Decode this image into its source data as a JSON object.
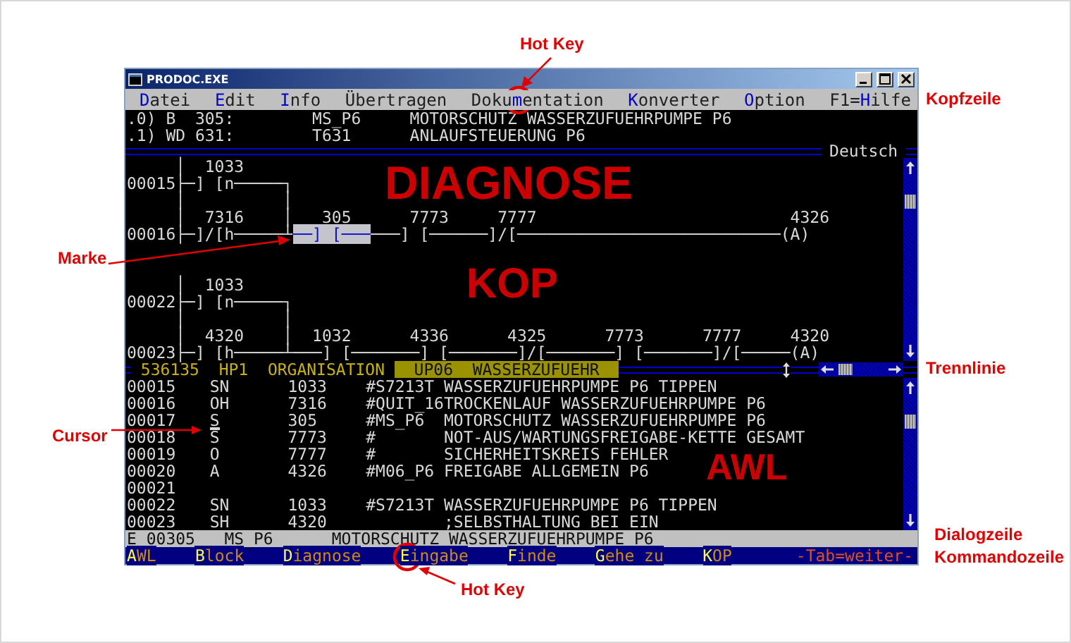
{
  "annotations": {
    "hot_key_top": "Hot Key",
    "diagnose": "DIAGNOSE",
    "kop": "KOP",
    "awl": "AWL",
    "marke": "Marke",
    "cursor": "Cursor",
    "kopfzeile": "Kopfzeile",
    "trennlinie": "Trennlinie",
    "dialogzeile": "Dialogzeile",
    "kommandozeile": "Kommandozeile",
    "hot_key_bottom": "Hot Key"
  },
  "window": {
    "title": "PRODOC.EXE"
  },
  "menu": [
    {
      "parts": [
        {
          "text": "D",
          "hotkey": true
        },
        {
          "text": "atei",
          "hotkey": false
        }
      ]
    },
    {
      "parts": [
        {
          "text": "E",
          "hotkey": true
        },
        {
          "text": "dit",
          "hotkey": false
        }
      ]
    },
    {
      "parts": [
        {
          "text": "I",
          "hotkey": true
        },
        {
          "text": "nfo",
          "hotkey": false
        }
      ]
    },
    {
      "parts": [
        {
          "text": "Übertragen",
          "hotkey": false
        }
      ]
    },
    {
      "parts": [
        {
          "text": "Doku",
          "hotkey": false
        },
        {
          "text": "m",
          "hotkey": true
        },
        {
          "text": "entation",
          "hotkey": false
        }
      ]
    },
    {
      "parts": [
        {
          "text": "K",
          "hotkey": true
        },
        {
          "text": "onverter",
          "hotkey": false
        }
      ]
    },
    {
      "parts": [
        {
          "text": "O",
          "hotkey": true
        },
        {
          "text": "ption",
          "hotkey": false
        }
      ]
    },
    {
      "parts": [
        {
          "text": "F1=",
          "hotkey": false
        },
        {
          "text": "H",
          "hotkey": true
        },
        {
          "text": "ilfe",
          "hotkey": false
        }
      ]
    }
  ],
  "header_lines": [
    {
      "index": ".0)",
      "op": "B",
      "address": "305:",
      "symbol": "MS_P6",
      "comment": "MOTORSCHUTZ WASSERZUFUEHRPUMPE P6"
    },
    {
      "index": ".1)",
      "op": "WD",
      "address": "631:",
      "symbol": "T631",
      "comment": "ANLAUFSTEUERUNG P6"
    }
  ],
  "language": "Deutsch",
  "kop": {
    "networks": [
      {
        "lines": [
          {
            "segments": [
              {
                "text": "     │  1033",
                "marked": false
              }
            ]
          },
          {
            "segments": [
              {
                "text": "00015├─] [n─────┐",
                "marked": false
              }
            ]
          },
          {
            "segments": [
              {
                "text": "     │          │",
                "marked": false
              }
            ]
          },
          {
            "segments": [
              {
                "text": "     │  7316    │   305      7773     7777                          4326",
                "marked": false
              }
            ]
          },
          {
            "segments": [
              {
                "text": "00016├─]/[h─────┴",
                "marked": false
              },
              {
                "text": "──] [───",
                "marked": true
              },
              {
                "text": "───] [──────]/[───────────────────────────(A)",
                "marked": false
              }
            ]
          }
        ]
      },
      {
        "lines": [
          {
            "segments": [
              {
                "text": "     │  1033",
                "marked": false
              }
            ]
          },
          {
            "segments": [
              {
                "text": "00022├─] [n─────┐",
                "marked": false
              }
            ]
          },
          {
            "segments": [
              {
                "text": "     │          │",
                "marked": false
              }
            ]
          },
          {
            "segments": [
              {
                "text": "     │  4320    │  1032      4336      4325      7773      7777     4320",
                "marked": false
              }
            ]
          },
          {
            "segments": [
              {
                "text": "00023├─] [h─────┴───] [───────] [───────]/[───────] [───────]/[─────(A)",
                "marked": false
              }
            ]
          }
        ]
      }
    ]
  },
  "status_line": [
    {
      "text": "536135",
      "selected": false
    },
    {
      "text": "HP1",
      "selected": false
    },
    {
      "text": "ORGANISATION",
      "selected": false
    },
    {
      "text": "UP06  WASSERZUFUEHR",
      "selected": true
    }
  ],
  "awl": [
    {
      "line": "00015",
      "op": "SN",
      "operand": "1033",
      "comment": "#S7213T WASSERZUFUEHRPUMPE P6 TIPPEN",
      "cursor": false
    },
    {
      "line": "00016",
      "op": "OH",
      "operand": "7316",
      "comment": "#QUIT_16TROCKENLAUF WASSERZUFUEHRPUMPE P6",
      "cursor": false
    },
    {
      "line": "00017",
      "op": "S",
      "operand": "305",
      "comment": "#MS_P6  MOTORSCHUTZ WASSERZUFUEHRPUMPE P6",
      "cursor": true
    },
    {
      "line": "00018",
      "op": "S",
      "operand": "7773",
      "comment": "#       NOT-AUS/WARTUNGSFREIGABE-KETTE GESAMT",
      "cursor": false
    },
    {
      "line": "00019",
      "op": "O",
      "operand": "7777",
      "comment": "#       SICHERHEITSKREIS FEHLER",
      "cursor": false
    },
    {
      "line": "00020",
      "op": "A",
      "operand": "4326",
      "comment": "#M06_P6 FREIGABE ALLGEMEIN P6",
      "cursor": false
    },
    {
      "line": "00021",
      "cursor": false
    },
    {
      "line": "00022",
      "op": "SN",
      "operand": "1033",
      "comment": "#S7213T WASSERZUFUEHRPUMPE P6 TIPPEN",
      "cursor": false
    },
    {
      "line": "00023",
      "op": "SH",
      "operand": "4320",
      "comment": "        ;SELBSTHALTUNG BEI EIN",
      "cursor": false
    }
  ],
  "dialog_line": {
    "mode": "E",
    "line": "00305",
    "symbol": "MS_P6",
    "comment": "MOTORSCHUTZ WASSERZUFUEHRPUMPE P6"
  },
  "command_line": {
    "items": [
      {
        "parts": [
          {
            "text": "A",
            "hotkey": true
          },
          {
            "text": "WL",
            "hotkey": false
          }
        ]
      },
      {
        "parts": [
          {
            "text": "B",
            "hotkey": true
          },
          {
            "text": "lock",
            "hotkey": false
          }
        ]
      },
      {
        "parts": [
          {
            "text": "D",
            "hotkey": true
          },
          {
            "text": "iagnose",
            "hotkey": false
          }
        ]
      },
      {
        "parts": [
          {
            "text": "E",
            "hotkey": true
          },
          {
            "text": "ingabe",
            "hotkey": false
          }
        ]
      },
      {
        "parts": [
          {
            "text": "F",
            "hotkey": true
          },
          {
            "text": "inde",
            "hotkey": false
          }
        ]
      },
      {
        "parts": [
          {
            "text": "G",
            "hotkey": true
          },
          {
            "text": "ehe zu",
            "hotkey": false
          }
        ]
      },
      {
        "parts": [
          {
            "text": "K",
            "hotkey": true
          },
          {
            "text": "OP",
            "hotkey": false
          }
        ]
      }
    ],
    "hint": "-Tab=weiter-"
  }
}
